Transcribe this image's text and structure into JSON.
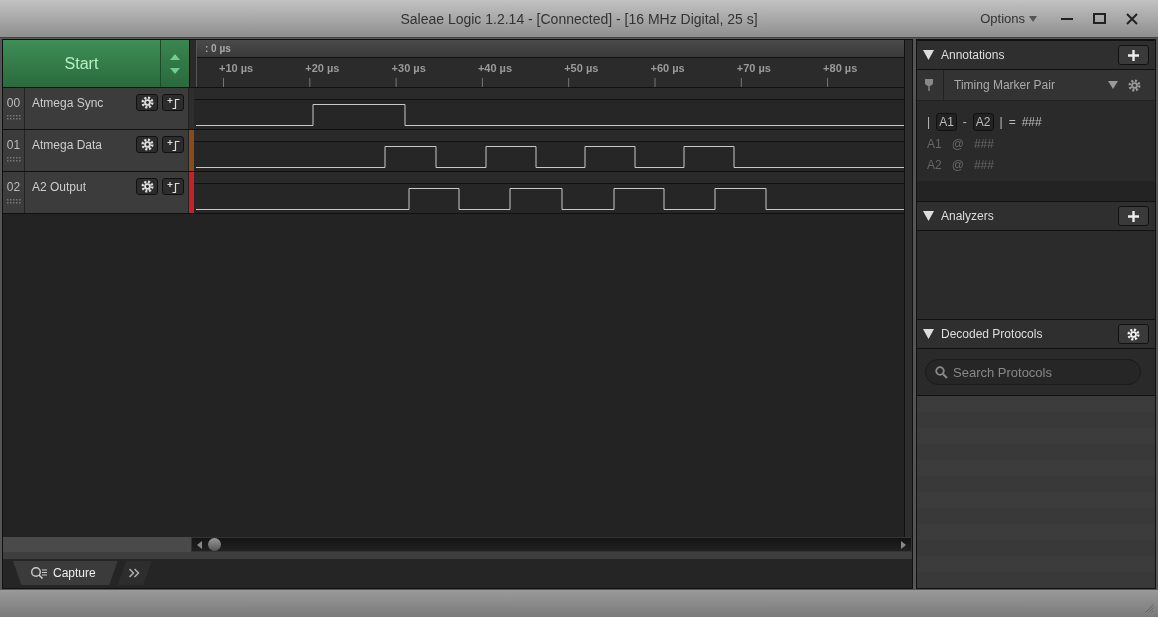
{
  "window": {
    "title": "Saleae Logic 1.2.14 - [Connected] - [16 MHz Digital, 25 s]",
    "menu": "Options"
  },
  "capture": {
    "start_label": "Start"
  },
  "timeline": {
    "origin_label": ": 0 µs",
    "ticks": [
      "+10 µs",
      "+20 µs",
      "+30 µs",
      "+40 µs",
      "+50 µs",
      "+60 µs",
      "+70 µs",
      "+80 µs"
    ]
  },
  "channels": [
    {
      "index": "00",
      "name": "Atmega Sync",
      "color": "#2e2e2e"
    },
    {
      "index": "01",
      "name": "Atmega Data",
      "color": "#8a4a1c"
    },
    {
      "index": "02",
      "name": "A2 Output",
      "color": "#c8202a"
    }
  ],
  "tabs": [
    {
      "label": "Capture",
      "selected": true
    }
  ],
  "annotations": {
    "title": "Annotations",
    "marker_type": "Timing Marker Pair",
    "expression": {
      "bar_left": "|",
      "a": "A1",
      "minus": "-",
      "b": "A2",
      "bar_right": "|",
      "equals": "=",
      "value": "###"
    },
    "markers": [
      {
        "name": "A1",
        "at": "@",
        "value": "###"
      },
      {
        "name": "A2",
        "at": "@",
        "value": "###"
      }
    ]
  },
  "analyzers": {
    "title": "Analyzers"
  },
  "decoded_protocols": {
    "title": "Decoded Protocols",
    "search_placeholder": "Search Protocols"
  }
}
